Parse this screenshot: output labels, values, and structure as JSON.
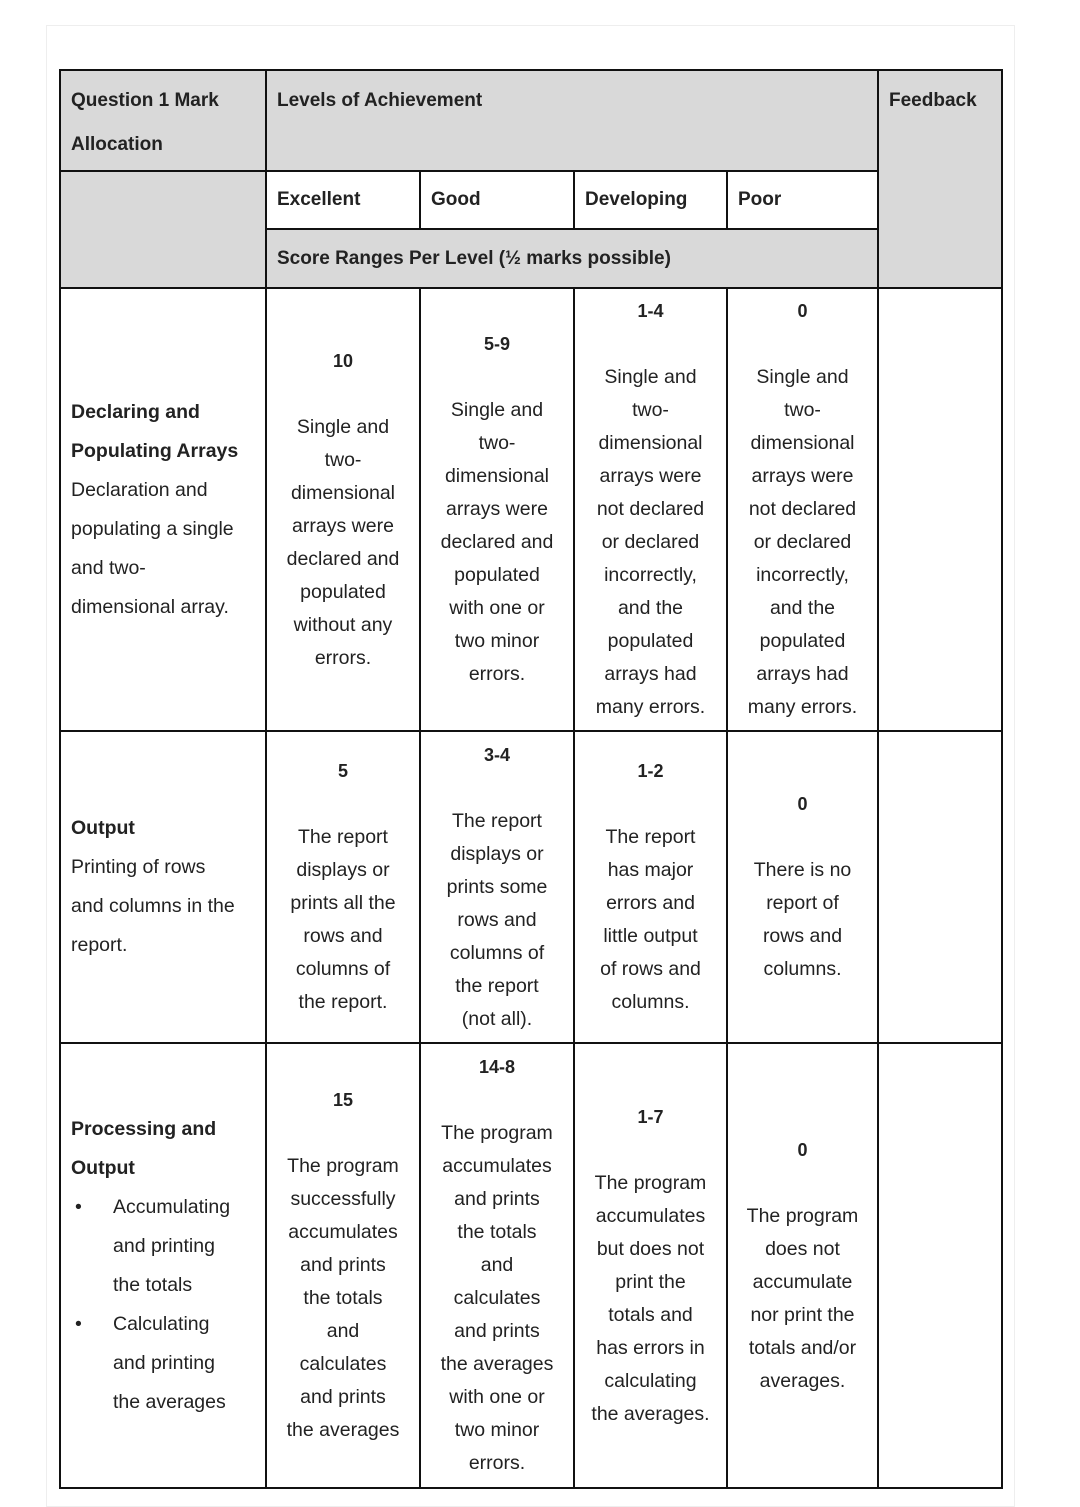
{
  "header": {
    "criteria_title": "Question 1 Mark\nAllocation",
    "levels_title": "Levels of Achievement",
    "feedback_title": "Feedback",
    "levels": [
      "Excellent",
      "Good",
      "Developing",
      "Poor"
    ],
    "score_ranges_title": "Score Ranges Per Level (½ marks possible)"
  },
  "rows": [
    {
      "title": "Declaring and\nPopulating Arrays",
      "desc": "Declaration and\npopulating a single\nand two-\ndimensional array.",
      "cells": [
        {
          "score": "10",
          "text": "Single and\ntwo-\ndimensional\narrays were\ndeclared and\npopulated\nwithout any\nerrors."
        },
        {
          "score": "5-9",
          "text": "Single and\ntwo-\ndimensional\narrays were\ndeclared and\npopulated\nwith one or\ntwo minor\nerrors."
        },
        {
          "score": "1-4",
          "text": "Single and\ntwo-\ndimensional\narrays were\nnot declared\nor declared\nincorrectly,\nand the\npopulated\narrays had\nmany errors."
        },
        {
          "score": "0",
          "text": "Single and\ntwo-\ndimensional\narrays were\nnot declared\nor declared\nincorrectly,\nand the\npopulated\narrays had\nmany errors."
        }
      ]
    },
    {
      "title": "Output",
      "desc": "Printing of rows\nand columns in the\nreport.",
      "cells": [
        {
          "score": "5",
          "text": "The report\ndisplays or\nprints all the\nrows and\ncolumns of\nthe report."
        },
        {
          "score": "3-4",
          "text": "The report\ndisplays or\nprints some\nrows and\ncolumns of\nthe report\n(not all)."
        },
        {
          "score": "1-2",
          "text": "The report\nhas major\nerrors and\nlittle output\nof rows and\ncolumns."
        },
        {
          "score": "0",
          "text": "There is no\nreport of\nrows and\ncolumns."
        }
      ]
    },
    {
      "title": "Processing and\nOutput",
      "bullets": [
        "Accumulating\nand printing\nthe totals",
        "Calculating\nand printing\nthe averages"
      ],
      "cells": [
        {
          "score": "15",
          "text": "The program\nsuccessfully\naccumulates\nand prints\nthe totals\nand\ncalculates\nand prints\nthe averages"
        },
        {
          "score": "14-8",
          "text": "The program\naccumulates\nand prints\nthe totals\nand\ncalculates\nand prints\nthe averages\nwith one or\ntwo minor\nerrors."
        },
        {
          "score": "1-7",
          "text": "The program\naccumulates\nbut does not\nprint the\ntotals and\nhas errors in\ncalculating\nthe averages."
        },
        {
          "score": "0",
          "text": "The program\ndoes not\naccumulate\nnor print the\ntotals and/or\naverages."
        }
      ]
    }
  ]
}
